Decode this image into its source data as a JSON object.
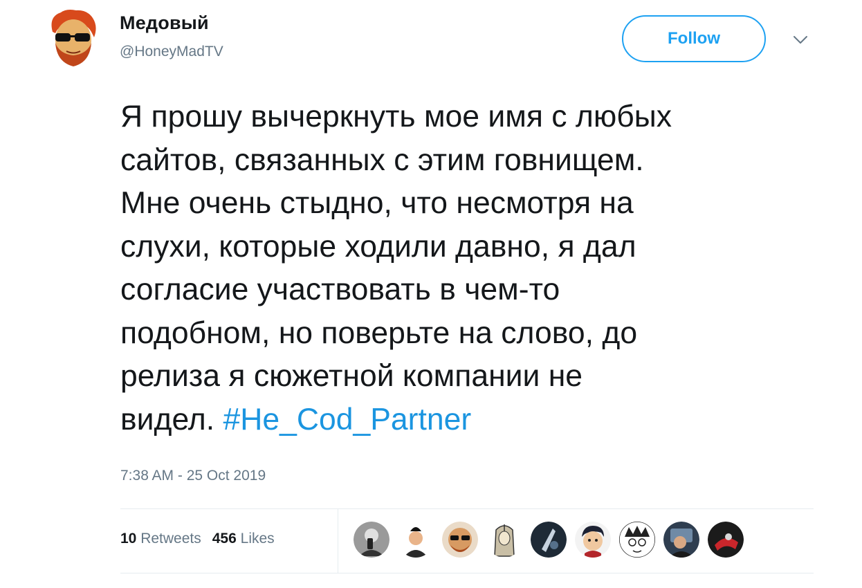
{
  "user": {
    "display_name": "Медовый",
    "handle": "@HoneyMadTV",
    "avatar_icon": "bearded-man-sunglasses-avatar"
  },
  "follow_label": "Follow",
  "menu_icon": "chevron-down-icon",
  "tweet": {
    "lines": [
      "Я прошу вычеркнуть мое имя с любых",
      "сайтов, связанных с этим говнищем.",
      "Мне очень стыдно, что несмотря на",
      "слухи, которые ходили давно, я дал",
      "согласие участвовать в чем-то",
      "подобном, но поверьте на слово, до",
      "релиза я сюжетной компании не"
    ],
    "last_line_text": "видел.",
    "hashtag": "#Не_Cod_Partner"
  },
  "timestamp": "7:38 AM - 25 Oct 2019",
  "stats": {
    "retweets_count": "10",
    "retweets_label": "Retweets",
    "likes_count": "456",
    "likes_label": "Likes"
  },
  "likers_count_shown": 9,
  "colors": {
    "accent": "#1da1f2",
    "hashtag": "#1b95e0",
    "text": "#14171a",
    "secondary": "#657786",
    "divider": "#e6ecf0"
  }
}
